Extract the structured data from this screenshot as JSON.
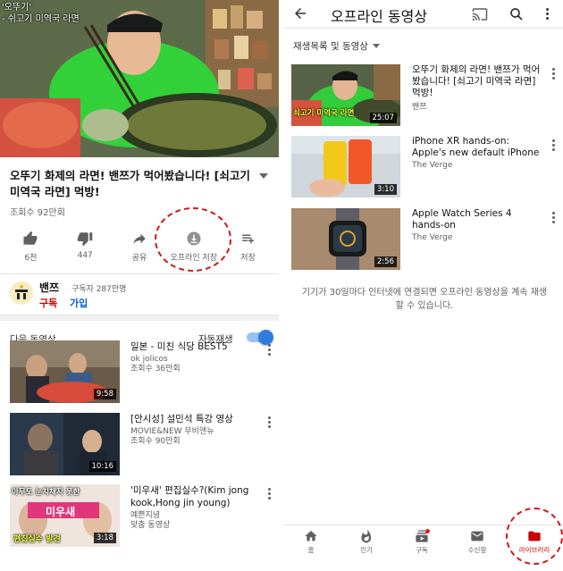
{
  "left": {
    "hero_caption": [
      "'오뚜기'",
      "- 쉬고기 미역국 라면"
    ],
    "video_title": "오뚜기 화제의 라면! 밴쯔가 먹어봤습니다! [쇠고기 미역국 라면] 먹방!",
    "view_count": "조회수 92만회",
    "actions": {
      "like": "6천",
      "dislike": "447",
      "share": "공유",
      "offline_save": "오프라인 저장",
      "save": "저장"
    },
    "channel": {
      "name": "밴쯔",
      "subscribers": "구독자 287만명",
      "subscribe": "구독",
      "join": "가입"
    },
    "up_next": "다음 동영상",
    "autoplay": "자동재생",
    "recommendations": [
      {
        "title": "일본 - 미친 식당 BEST5",
        "channel": "ok jolicos",
        "views": "조회수 36만회",
        "duration": "9:58"
      },
      {
        "title": "[안시성] 설민석 특강 영상",
        "channel": "MOVIE&NEW 무비앤뉴",
        "views": "조회수 90만회",
        "duration": "10:16"
      },
      {
        "title": "'미우새' 편집실수?(Kim jong kook,Hong jin young)",
        "channel": "예쁜지녕",
        "views": "맞춤 동영상",
        "duration": "3:18",
        "thumb_text_top": "아무도 눈치채지 못한",
        "thumb_text_mid": "미우새",
        "thumb_text_bottom": "편집실수 발견"
      }
    ]
  },
  "right": {
    "title": "오프라인 동영상",
    "sort_label": "재생목록 및 동영상",
    "videos": [
      {
        "title": "오뚜기 화제의 라면! 밴쯔가 먹어봤습니다! [쇠고기 미역국 라면] 먹방!",
        "channel": "밴쯔",
        "duration": "25:07",
        "thumb_text": "쇠고기 미역국 라면"
      },
      {
        "title": "iPhone XR hands-on: Apple's new default iPhone",
        "channel": "The Verge",
        "duration": "3:10"
      },
      {
        "title": "Apple Watch Series 4 hands-on",
        "channel": "The Verge",
        "duration": "2:56"
      }
    ],
    "note": "기기가 30일마다 인터넷에 연결되면 오프라인 동영상을 계속 재생할 수 있습니다.",
    "nav": {
      "home": "홈",
      "trending": "인기",
      "subscriptions": "구독",
      "inbox": "수신함",
      "library": "라이브러리"
    }
  },
  "colors": {
    "accent_red": "#cc0000",
    "toggle_blue": "#2f7de1",
    "link_blue": "#065fd4",
    "annotation_red": "#d01818"
  }
}
